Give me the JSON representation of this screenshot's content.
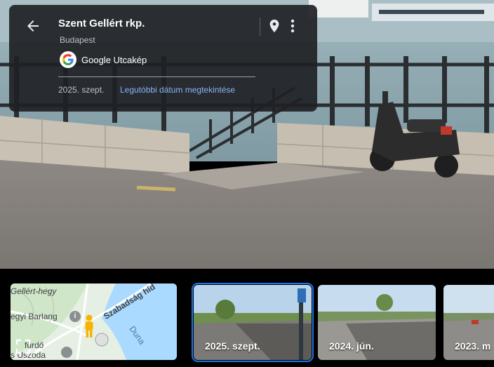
{
  "place": {
    "title": "Szent Gellért rkp.",
    "subtitle": "Budapest",
    "provider": "Google Utcakép",
    "current_date": "2025. szept.",
    "latest_link": "Legutóbbi dátum megtekintése"
  },
  "icons": [
    "back-arrow-icon",
    "location-pin-icon",
    "more-vert-icon",
    "google-logo-icon",
    "fullscreen-icon",
    "pegman-icon",
    "info-icon"
  ],
  "map": {
    "labels": {
      "gellert": "Gellért-hegy",
      "barlang": "egyi Barlang",
      "bridge": "Szabadság híd",
      "river": "Duna",
      "furdo": "fürdő",
      "uszoda": "s Uszoda"
    }
  },
  "timeline": [
    {
      "label": "2025. szept.",
      "selected": true
    },
    {
      "label": "2024. jún.",
      "selected": false
    },
    {
      "label": "2023. m",
      "selected": false
    }
  ],
  "colors": {
    "accent": "#1a73e8",
    "link": "#8ab4f8",
    "card": "#202124",
    "river": "#aadaff"
  }
}
